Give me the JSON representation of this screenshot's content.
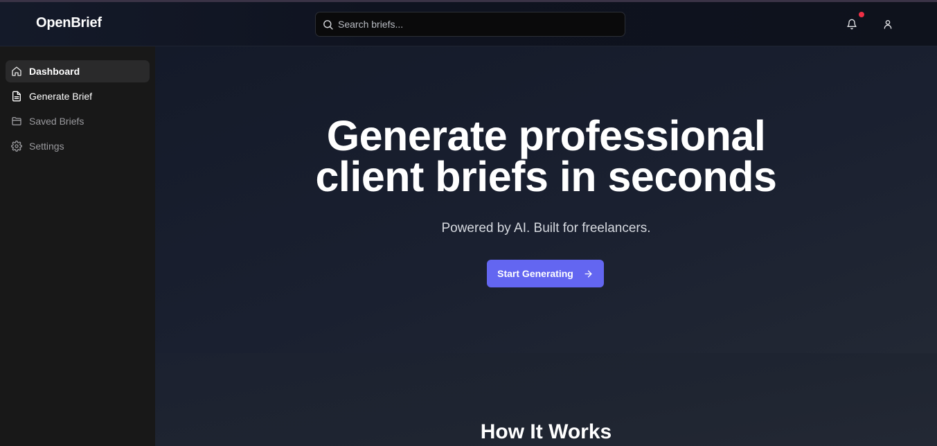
{
  "header": {
    "brand": "OpenBrief",
    "search_placeholder": "Search briefs...",
    "icons": [
      "search-icon",
      "bell-icon",
      "user-icon"
    ],
    "notification_dot_color": "#ef2f45"
  },
  "sidebar": {
    "items": [
      {
        "label": "Dashboard",
        "icon": "home-icon",
        "active": true
      },
      {
        "label": "Generate Brief",
        "icon": "file-text-icon",
        "active": false
      },
      {
        "label": "Saved Briefs",
        "icon": "folder-icon",
        "active": false
      },
      {
        "label": "Settings",
        "icon": "gear-icon",
        "active": false
      }
    ]
  },
  "hero": {
    "title_line1": "Generate professional",
    "title_line2": "client briefs in seconds",
    "subtitle": "Powered by AI. Built for freelancers.",
    "cta_label": "Start Generating",
    "cta_icon": "arrow-right-icon",
    "accent_color": "#6366f1"
  },
  "how_it_works": {
    "title": "How It Works"
  }
}
